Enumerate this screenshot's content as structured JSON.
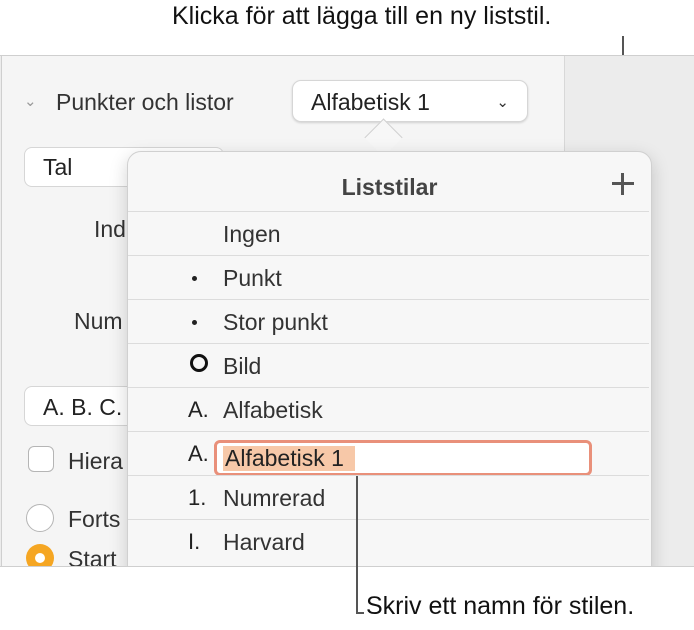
{
  "callouts": {
    "top": "Klicka för att lägga till en ny liststil.",
    "bottom": "Skriv ett namn för stilen."
  },
  "sidebar": {
    "section_title": "Punkter och listor",
    "list_style_value": "Alfabetisk 1",
    "type_value": "Tal",
    "indent_label_partial": "Ind",
    "numbering_label_partial": "Num",
    "format_value_partial": "A. B. C.",
    "hierarchy_label_partial": "Hiera",
    "hierarchy_checked": false,
    "continue_label_partial": "Forts",
    "start_label_partial": "Start",
    "selected_radio": "start"
  },
  "popover": {
    "title": "Liststilar",
    "items": [
      {
        "marker": "",
        "label": "Ingen"
      },
      {
        "marker": "bullet",
        "label": "Punkt"
      },
      {
        "marker": "bullet",
        "label": "Stor punkt"
      },
      {
        "marker": "image-ring",
        "label": "Bild"
      },
      {
        "marker": "A.",
        "label": "Alfabetisk"
      },
      {
        "marker": "A.",
        "label": "Alfabetisk 1",
        "editing": true
      },
      {
        "marker": "1.",
        "label": "Numrerad"
      },
      {
        "marker": "I.",
        "label": "Harvard"
      }
    ]
  },
  "colors": {
    "accent": "#f5a623",
    "edit_ring": "#e9907a",
    "selection": "#f7c8a8"
  }
}
